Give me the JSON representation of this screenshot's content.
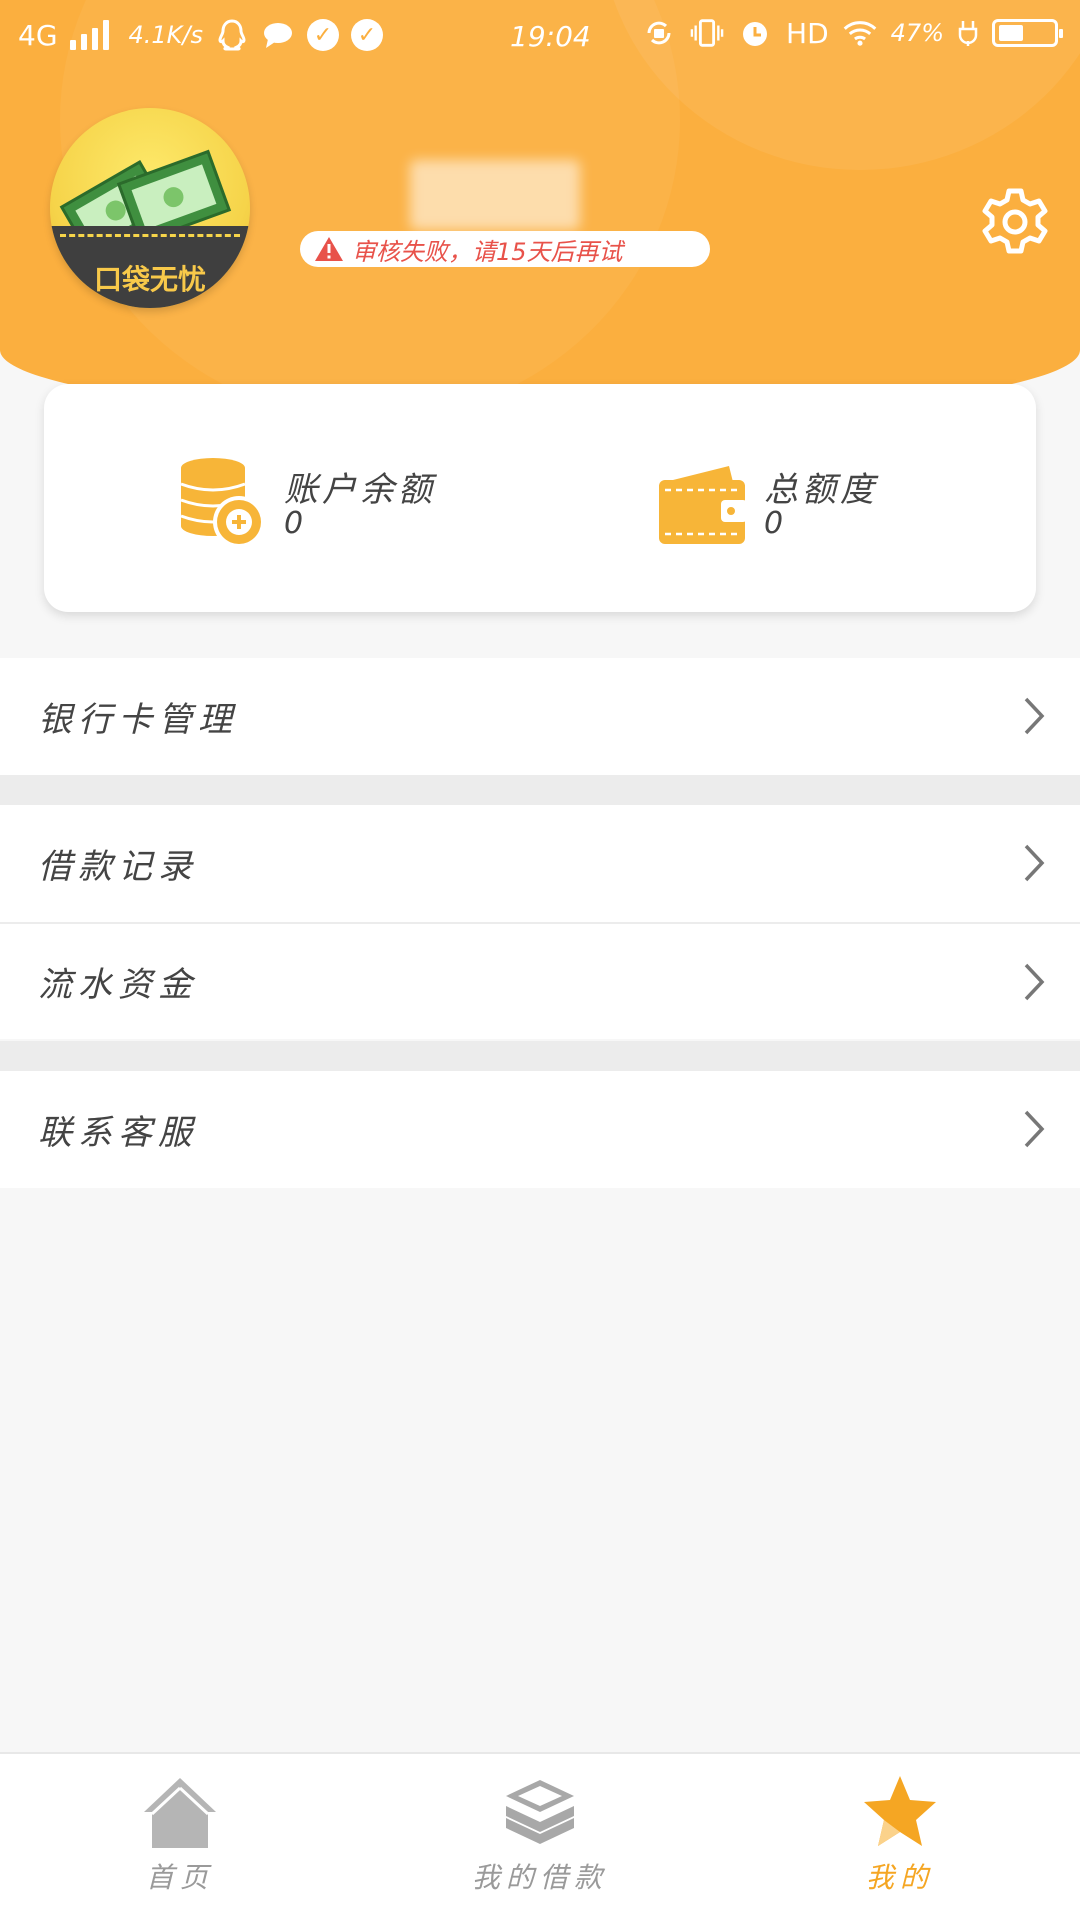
{
  "status_bar": {
    "network": "4G",
    "speed": "4.1K/s",
    "time": "19:04",
    "hd": "HD",
    "battery": "47%",
    "battery_level": 0.47
  },
  "profile": {
    "logo_text": "口袋无忧",
    "status_badge": "审核失败，请15天后再试"
  },
  "balance_card": {
    "account_balance_label": "账户余额",
    "account_balance_value": "0",
    "total_limit_label": "总额度",
    "total_limit_value": "0"
  },
  "menu": {
    "bank_card": "银行卡管理",
    "loan_records": "借款记录",
    "cash_flow": "流水资金",
    "contact_service": "联系客服"
  },
  "bottom_nav": {
    "home": "首页",
    "my_loans": "我的借款",
    "mine": "我的"
  },
  "colors": {
    "brand": "#fbaf3f",
    "active_tab": "#f5a623",
    "warning": "#e8524a",
    "inactive": "#9a9a9a"
  },
  "icons": {
    "settings": "gear-icon",
    "balance": "coins-icon",
    "limit": "wallet-icon",
    "home_tab": "house-icon",
    "loans_tab": "layers-icon",
    "mine_tab": "star-icon"
  }
}
